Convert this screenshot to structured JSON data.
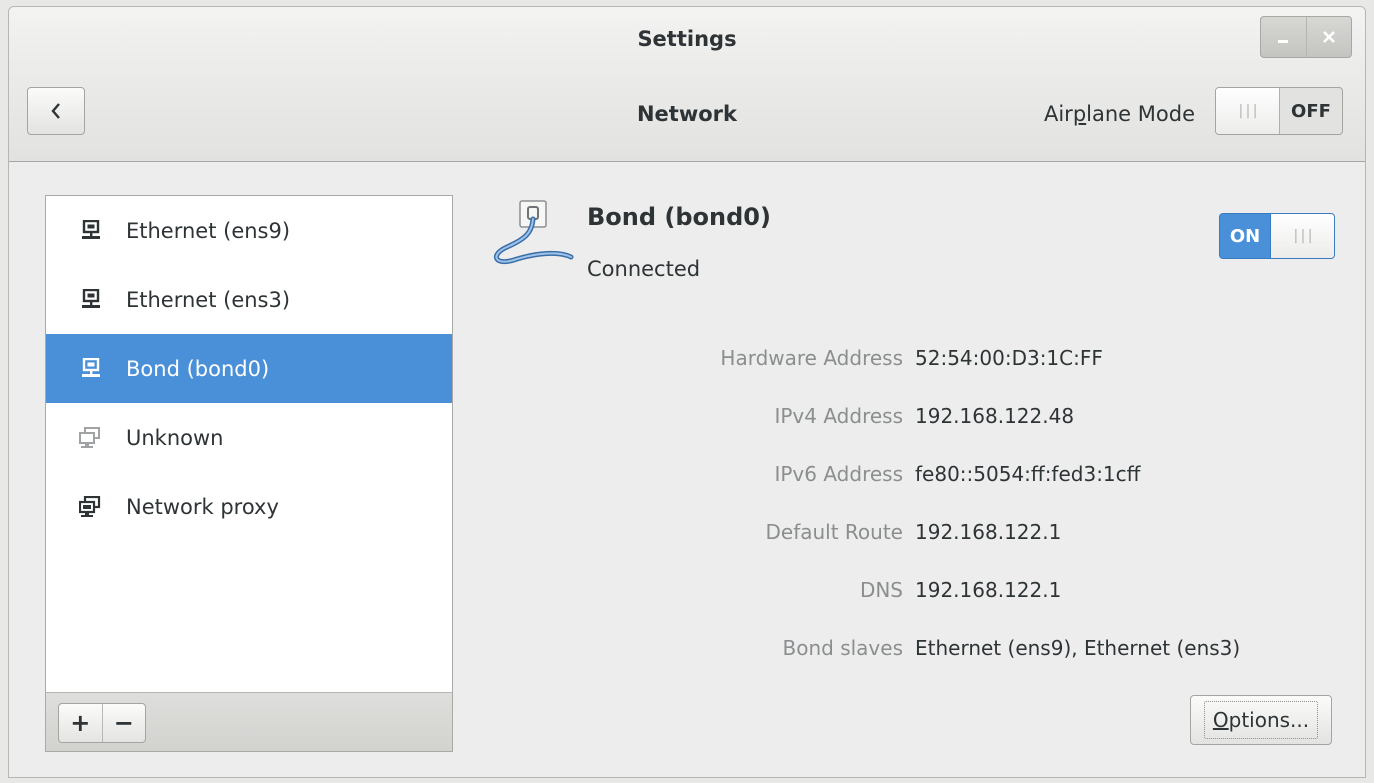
{
  "window": {
    "title": "Settings"
  },
  "header": {
    "page_title": "Network",
    "airplane_pre": "Air",
    "airplane_mnemonic": "p",
    "airplane_post": "lane Mode",
    "airplane_state": "OFF"
  },
  "sidebar": {
    "items": [
      {
        "label": "Ethernet (ens9)",
        "icon": "wired-network-icon"
      },
      {
        "label": "Ethernet (ens3)",
        "icon": "wired-network-icon"
      },
      {
        "label": "Bond (bond0)",
        "icon": "wired-network-icon",
        "selected": true
      },
      {
        "label": "Unknown",
        "icon": "network-disconnected-icon"
      },
      {
        "label": "Network proxy",
        "icon": "network-proxy-icon"
      }
    ],
    "add_label": "+",
    "remove_label": "−"
  },
  "device": {
    "name": "Bond (bond0)",
    "status": "Connected",
    "switch_state": "ON"
  },
  "details": [
    {
      "key": "Hardware Address",
      "value": "52:54:00:D3:1C:FF"
    },
    {
      "key": "IPv4 Address",
      "value": "192.168.122.48"
    },
    {
      "key": "IPv6 Address",
      "value": "fe80::5054:ff:fed3:1cff"
    },
    {
      "key": "Default Route",
      "value": "192.168.122.1"
    },
    {
      "key": "DNS",
      "value": "192.168.122.1"
    },
    {
      "key": "Bond slaves",
      "value": "Ethernet (ens9), Ethernet (ens3)"
    }
  ],
  "options": {
    "mnemonic": "O",
    "rest": "ptions..."
  },
  "colors": {
    "accent": "#4a90d9",
    "window_bg": "#ededed"
  }
}
